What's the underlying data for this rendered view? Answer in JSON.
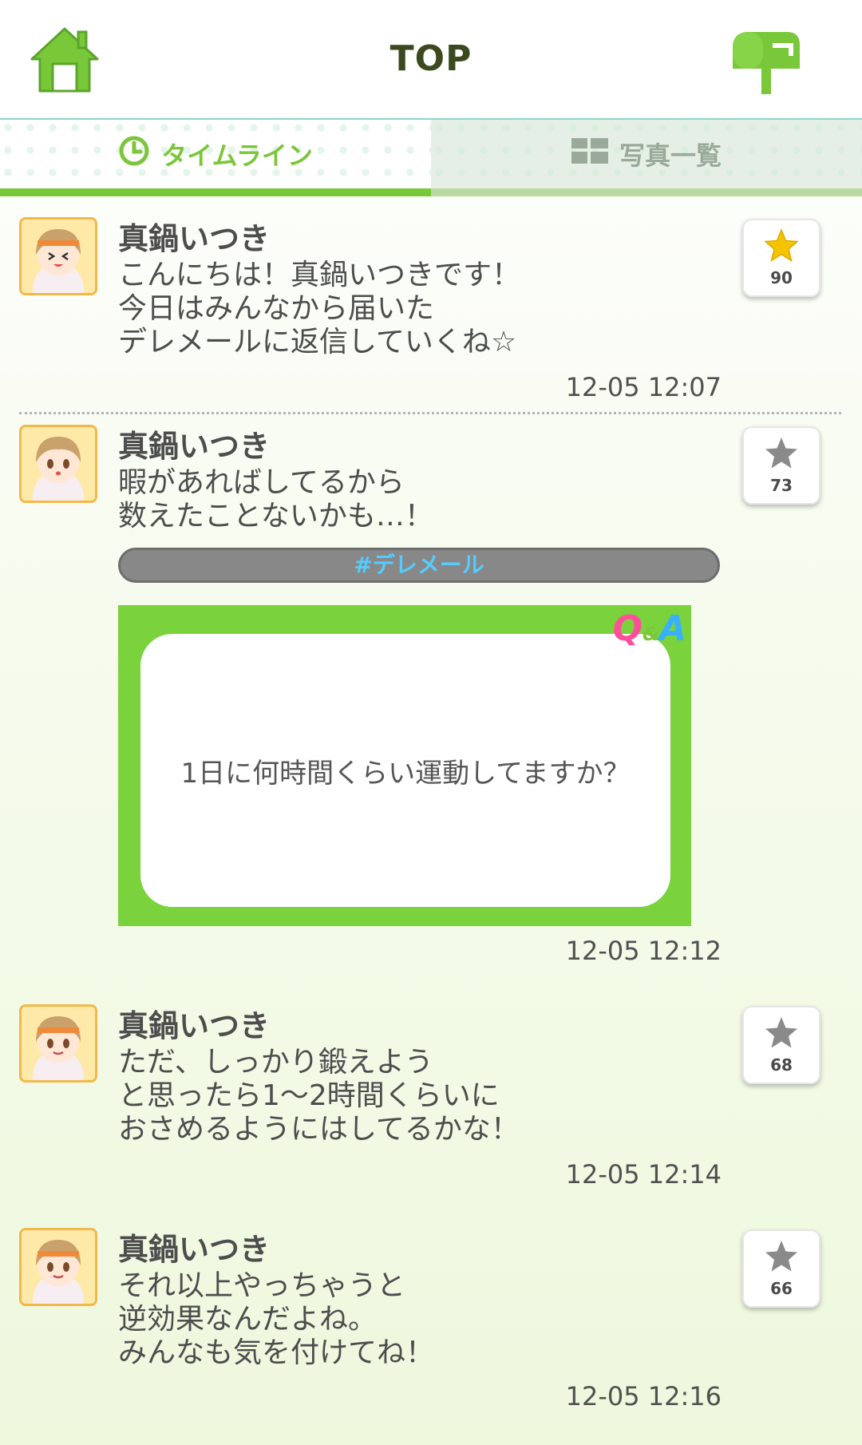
{
  "header": {
    "title": "TOP"
  },
  "tabs": [
    {
      "label": "タイムライン",
      "active": true
    },
    {
      "label": "写真一覧",
      "active": false
    }
  ],
  "colors": {
    "accent": "#79c83a",
    "tag_text": "#55ccff",
    "star_active": "#f5c400",
    "star_inactive": "#8a8a8a"
  },
  "posts": [
    {
      "author": "真鍋いつき",
      "text": "こんにちは！真鍋いつきです！\n今日はみんなから届いた\nデレメールに返信していくね☆",
      "time": "12-05 12:07",
      "fav_count": "90",
      "starred": true
    },
    {
      "author": "真鍋いつき",
      "text": "暇があればしてるから\n数えたことないかも…！",
      "tag": "#デレメール",
      "qa_question": "1日に何時間くらい運動してますか？",
      "qa_logo": {
        "q": "Q",
        "amp": "&",
        "a": "A"
      },
      "time": "12-05 12:12",
      "fav_count": "73",
      "starred": false
    },
    {
      "author": "真鍋いつき",
      "text": "ただ、しっかり鍛えよう\nと思ったら1〜2時間くらいに\nおさめるようにはしてるかな！",
      "time": "12-05 12:14",
      "fav_count": "68",
      "starred": false
    },
    {
      "author": "真鍋いつき",
      "text": "それ以上やっちゃうと\n逆効果なんだよね。\nみんなも気を付けてね！",
      "time": "12-05 12:16",
      "fav_count": "66",
      "starred": false
    }
  ]
}
